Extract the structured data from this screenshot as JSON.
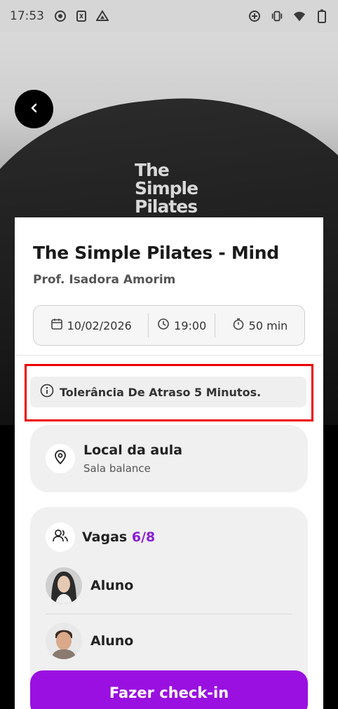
{
  "status_bar": {
    "time": "17:53",
    "left_icons": [
      "record-icon",
      "sim-icon",
      "drive-icon"
    ],
    "right_icons": [
      "data-saver-icon",
      "vibrate-icon",
      "wifi-icon",
      "battery-icon"
    ]
  },
  "hero": {
    "logo_lines": [
      "The",
      "Simple",
      "Pilates"
    ]
  },
  "class": {
    "title": "The Simple Pilates - Mind",
    "teacher": "Prof. Isadora Amorim",
    "date": "10/02/2026",
    "time": "19:00",
    "duration": "50 min"
  },
  "tolerance": {
    "text": "Tolerância De Atraso 5 Minutos."
  },
  "location": {
    "title": "Local da aula",
    "room": "Sala balance"
  },
  "vagas": {
    "label": "Vagas",
    "count": "6/8",
    "students": [
      {
        "name": "Aluno"
      },
      {
        "name": "Aluno"
      }
    ]
  },
  "checkin": {
    "label": "Fazer check-in"
  },
  "colors": {
    "accent": "#9a10e0",
    "vagas_count": "#8a1ed6",
    "highlight_frame": "#e00000"
  }
}
